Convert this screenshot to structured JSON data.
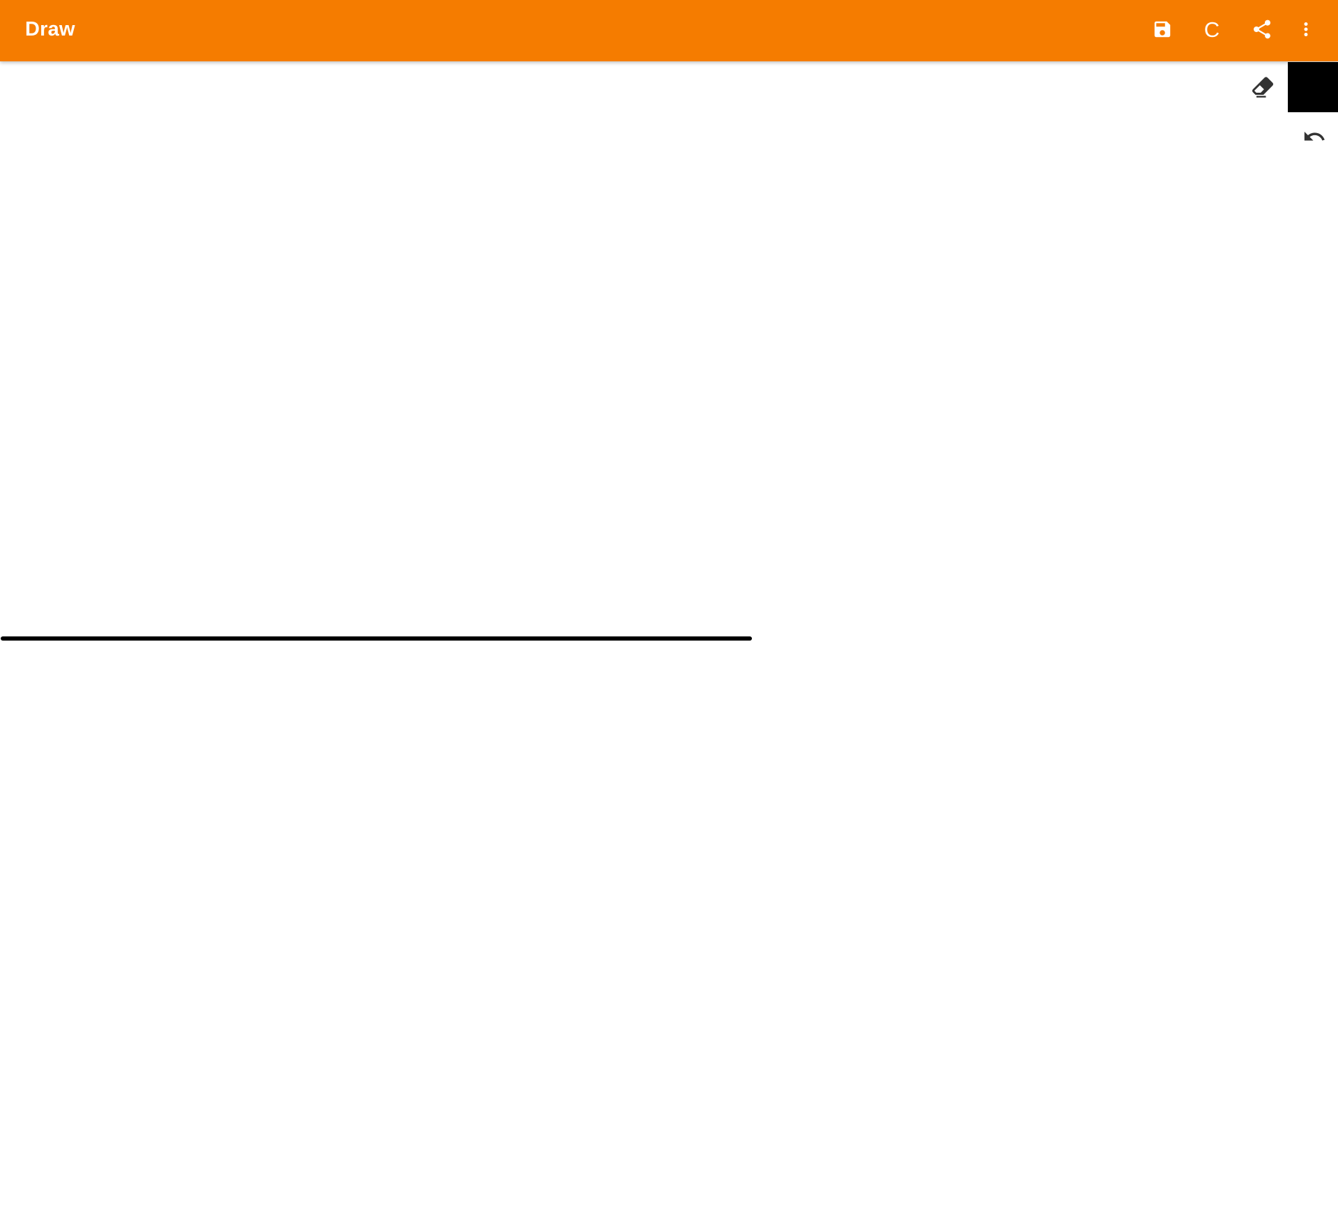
{
  "app": {
    "title": "Draw"
  },
  "toolbar": {
    "background_color": "#F57C00",
    "save_icon": "save-icon",
    "clear_label": "C",
    "share_icon": "share-icon",
    "more_icon": "more-vert-icon"
  },
  "tools": {
    "eraser_icon": "eraser-icon",
    "current_color": "#000000",
    "undo_icon": "undo-icon"
  },
  "canvas": {
    "background_color": "#FFFFFF",
    "stroke_color": "#000000"
  }
}
